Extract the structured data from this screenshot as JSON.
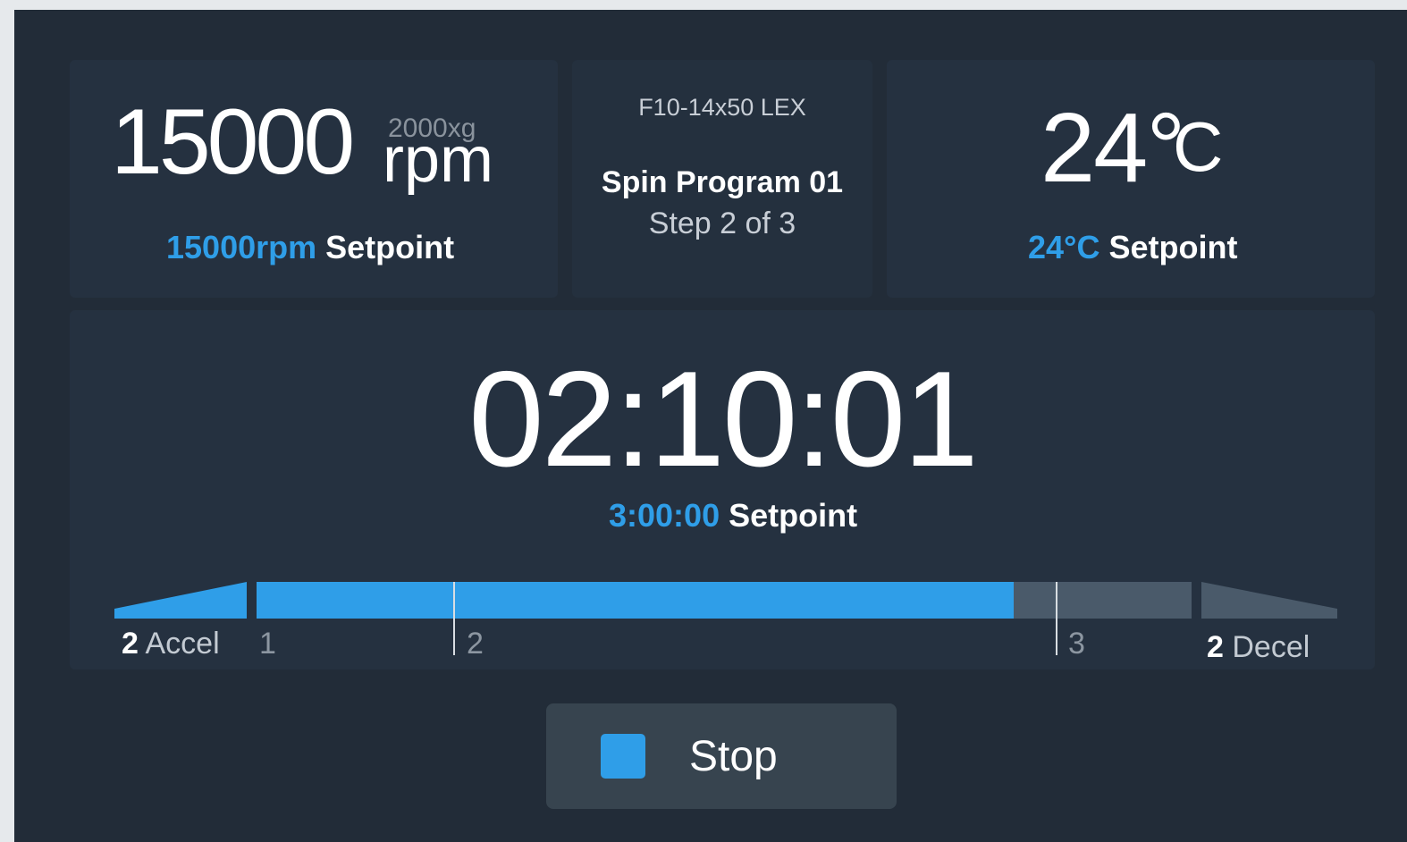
{
  "speed": {
    "value": "15000",
    "unit": "rpm",
    "rcf": "2000xg",
    "setpoint_value": "15000rpm",
    "setpoint_label": "Setpoint"
  },
  "program": {
    "rotor": "F10-14x50 LEX",
    "name": "Spin Program 01",
    "step": "Step 2 of 3"
  },
  "temperature": {
    "value": "24°",
    "unit": "C",
    "setpoint_value": "24°C",
    "setpoint_label": "Setpoint"
  },
  "timer": {
    "value": "02:10:01",
    "setpoint_value": "3:00:00",
    "setpoint_label": "Setpoint"
  },
  "progress": {
    "accel_level": "2",
    "accel_label": "Accel",
    "decel_level": "2",
    "decel_label": "Decel",
    "step_labels": [
      "1",
      "2",
      "3"
    ],
    "fraction_complete": 0.81,
    "colors": {
      "done": "#2f9ee8",
      "remaining": "#4a5a6a"
    }
  },
  "controls": {
    "stop_label": "Stop",
    "stop_icon": "stop-square-icon"
  }
}
